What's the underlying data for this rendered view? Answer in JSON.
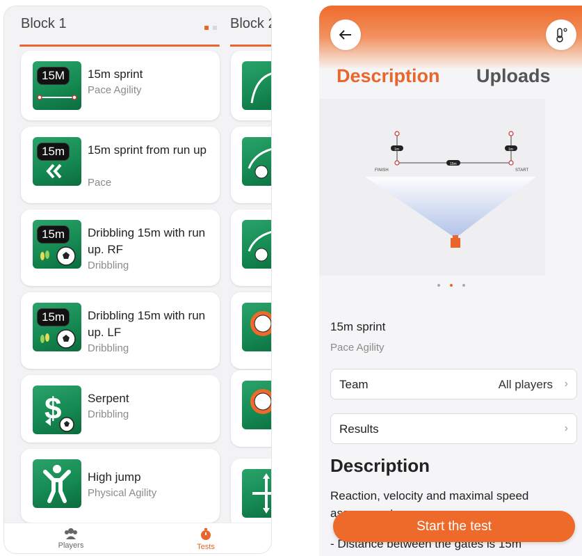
{
  "left": {
    "block1_title": "Block 1",
    "block2_title": "Block 2",
    "tests": [
      {
        "title": "15m sprint",
        "category": "Pace Agility",
        "badge": "15M",
        "icon": "sprint-gates-icon"
      },
      {
        "title": "15m sprint from run up",
        "category": "Pace",
        "badge": "15m",
        "icon": "double-chevron-icon"
      },
      {
        "title": "Dribbling 15m with run up. RF",
        "category": "Dribbling",
        "badge": "15m",
        "icon": "ball-feet-icon"
      },
      {
        "title": "Dribbling 15m with run up. LF",
        "category": "Dribbling",
        "badge": "15m",
        "icon": "ball-feet-icon"
      },
      {
        "title": "Serpent",
        "category": "Dribbling",
        "badge": "",
        "icon": "dollar-ball-icon"
      },
      {
        "title": "High jump",
        "category": "Physical Agility",
        "badge": "",
        "icon": "jumping-person-icon"
      }
    ],
    "nav": {
      "players": "Players",
      "tests": "Tests"
    }
  },
  "right": {
    "tabs": {
      "description": "Description",
      "uploads": "Uploads"
    },
    "diagram": {
      "gate_label_left": "1m",
      "gate_label_right": "1m",
      "distance_label": "15m",
      "finish": "FINISH",
      "start": "START"
    },
    "test_name": "15m sprint",
    "test_category": "Pace Agility",
    "team_label": "Team",
    "team_value": "All players",
    "results_label": "Results",
    "description_title": "Description",
    "description_text": "Reaction, velocity and maximal speed assessment",
    "description_line": "- Distance between the gates is 15m",
    "start_button": "Start the test"
  },
  "colors": {
    "accent": "#e8662c",
    "green": "#158a52"
  }
}
